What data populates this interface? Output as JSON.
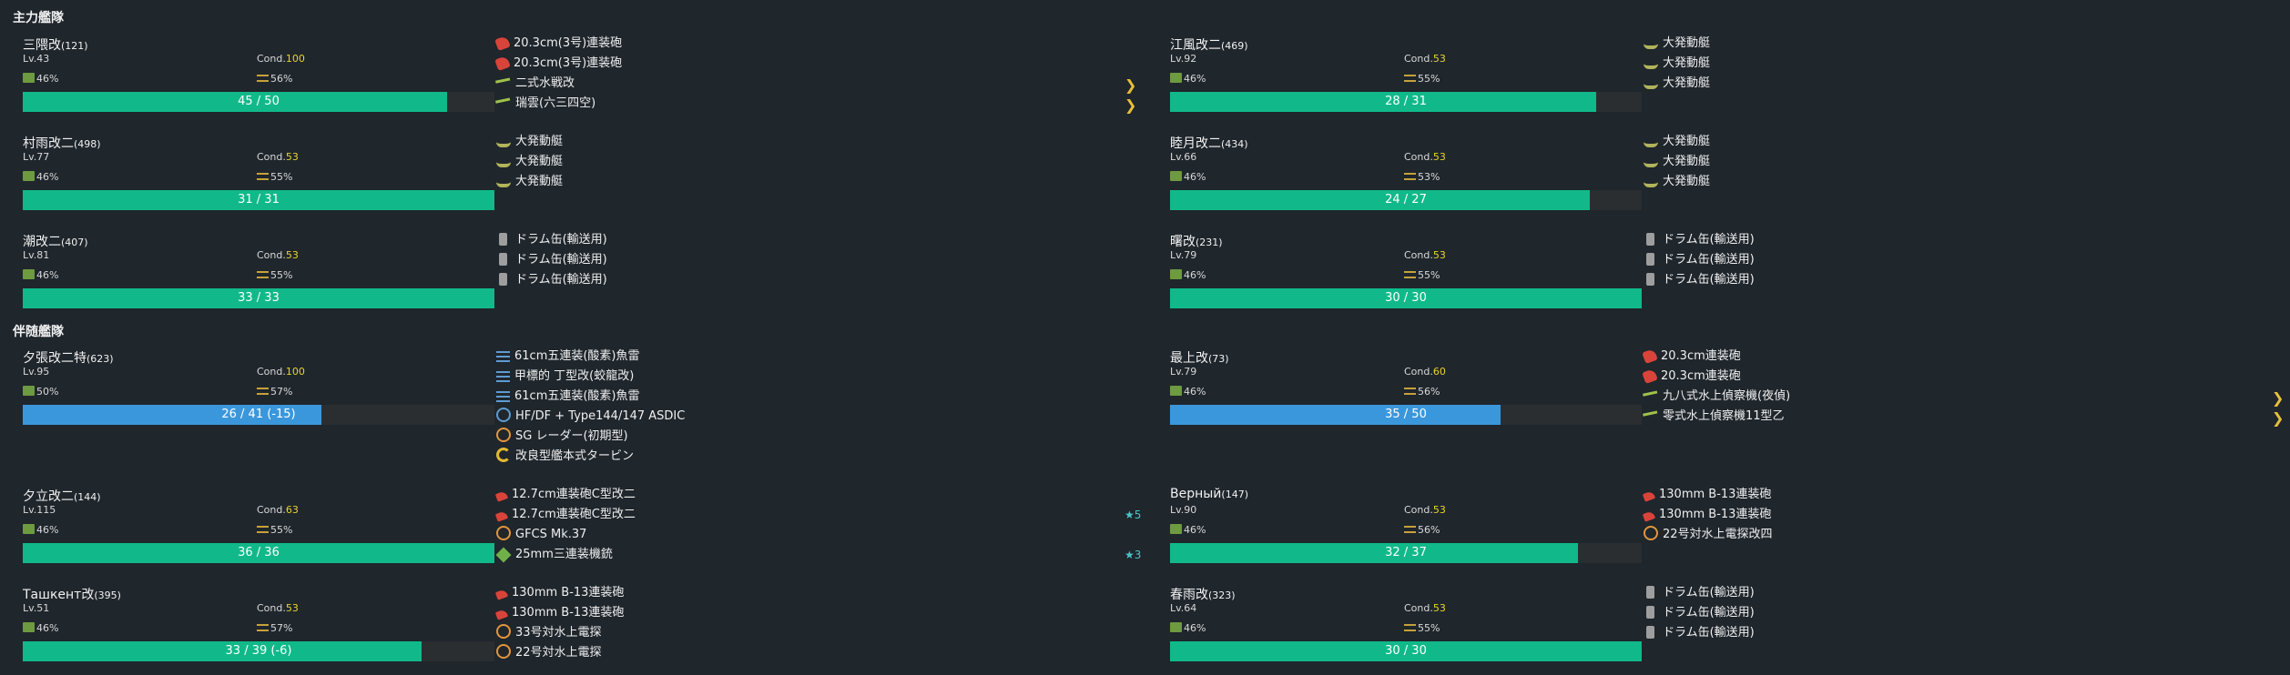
{
  "fleets": {
    "main_title": "主力艦隊",
    "escort_title": "伴随艦隊"
  },
  "labels": {
    "lv_prefix": "Lv.",
    "cond_prefix": "Cond."
  },
  "colors": {
    "hp_green": "#11b98a",
    "hp_blue": "#3b97dc",
    "cond_yellow": "#e8d42d",
    "star_cyan": "#4fc3c7"
  },
  "main_fleet": [
    {
      "name": "三隈改",
      "id": "(121)",
      "lv": "43",
      "cond": "100",
      "fuel": "46%",
      "ammo": "56%",
      "hp": "45 / 50",
      "hp_fraction": 0.9,
      "hp_color": "green",
      "equipment": [
        {
          "icon": "main-gun",
          "name": "20.3cm(3号)連装砲"
        },
        {
          "icon": "main-gun",
          "name": "20.3cm(3号)連装砲"
        },
        {
          "icon": "seaplane",
          "name": "二式水戦改",
          "badge": "chevron"
        },
        {
          "icon": "seaplane",
          "name": "瑞雲(六三四空)",
          "badge": "chevron"
        }
      ]
    },
    {
      "name": "江風改二",
      "id": "(469)",
      "lv": "92",
      "cond": "53",
      "fuel": "46%",
      "ammo": "55%",
      "hp": "28 / 31",
      "hp_fraction": 0.903,
      "hp_color": "green",
      "equipment": [
        {
          "icon": "landing",
          "name": "大発動艇"
        },
        {
          "icon": "landing",
          "name": "大発動艇"
        },
        {
          "icon": "landing",
          "name": "大発動艇"
        }
      ]
    },
    {
      "name": "村雨改二",
      "id": "(498)",
      "lv": "77",
      "cond": "53",
      "fuel": "46%",
      "ammo": "55%",
      "hp": "31 / 31",
      "hp_fraction": 1.0,
      "hp_color": "green",
      "equipment": [
        {
          "icon": "landing",
          "name": "大発動艇"
        },
        {
          "icon": "landing",
          "name": "大発動艇"
        },
        {
          "icon": "landing",
          "name": "大発動艇"
        }
      ]
    },
    {
      "name": "睦月改二",
      "id": "(434)",
      "lv": "66",
      "cond": "53",
      "fuel": "46%",
      "ammo": "53%",
      "hp": "24 / 27",
      "hp_fraction": 0.889,
      "hp_color": "green",
      "equipment": [
        {
          "icon": "landing",
          "name": "大発動艇"
        },
        {
          "icon": "landing",
          "name": "大発動艇"
        },
        {
          "icon": "landing",
          "name": "大発動艇"
        }
      ]
    },
    {
      "name": "潮改二",
      "id": "(407)",
      "lv": "81",
      "cond": "53",
      "fuel": "46%",
      "ammo": "55%",
      "hp": "33 / 33",
      "hp_fraction": 1.0,
      "hp_color": "green",
      "equipment": [
        {
          "icon": "drum",
          "name": "ドラム缶(輸送用)"
        },
        {
          "icon": "drum",
          "name": "ドラム缶(輸送用)"
        },
        {
          "icon": "drum",
          "name": "ドラム缶(輸送用)"
        }
      ]
    },
    {
      "name": "曙改",
      "id": "(231)",
      "lv": "79",
      "cond": "53",
      "fuel": "46%",
      "ammo": "55%",
      "hp": "30 / 30",
      "hp_fraction": 1.0,
      "hp_color": "green",
      "equipment": [
        {
          "icon": "drum",
          "name": "ドラム缶(輸送用)"
        },
        {
          "icon": "drum",
          "name": "ドラム缶(輸送用)"
        },
        {
          "icon": "drum",
          "name": "ドラム缶(輸送用)"
        }
      ]
    }
  ],
  "escort_fleet": [
    {
      "name": "夕張改二特",
      "id": "(623)",
      "lv": "95",
      "cond": "100",
      "fuel": "50%",
      "ammo": "57%",
      "hp": "26 / 41 (-15)",
      "hp_fraction": 0.634,
      "hp_color": "blue",
      "equipment": [
        {
          "icon": "torp",
          "name": "61cm五連装(酸素)魚雷"
        },
        {
          "icon": "torp",
          "name": "甲標的 丁型改(蛟龍改)"
        },
        {
          "icon": "torp",
          "name": "61cm五連装(酸素)魚雷"
        },
        {
          "icon": "sonar",
          "name": "HF/DF + Type144/147 ASDIC"
        },
        {
          "icon": "radar",
          "name": "SG レーダー(初期型)"
        },
        {
          "icon": "turbine",
          "name": "改良型艦本式タービン"
        }
      ]
    },
    {
      "name": "最上改",
      "id": "(73)",
      "lv": "79",
      "cond": "60",
      "fuel": "46%",
      "ammo": "56%",
      "hp": "35 / 50",
      "hp_fraction": 0.7,
      "hp_color": "blue",
      "equipment": [
        {
          "icon": "main-gun",
          "name": "20.3cm連装砲"
        },
        {
          "icon": "main-gun",
          "name": "20.3cm連装砲"
        },
        {
          "icon": "seaplane",
          "name": "九八式水上偵察機(夜偵)",
          "badge": "chevron"
        },
        {
          "icon": "seaplane",
          "name": "零式水上偵察機11型乙",
          "badge": "chevron"
        }
      ]
    },
    {
      "name": "夕立改二",
      "id": "(144)",
      "lv": "115",
      "cond": "63",
      "fuel": "46%",
      "ammo": "55%",
      "hp": "36 / 36",
      "hp_fraction": 1.0,
      "hp_color": "green",
      "equipment": [
        {
          "icon": "small-gun",
          "name": "12.7cm連装砲C型改二"
        },
        {
          "icon": "small-gun",
          "name": "12.7cm連装砲C型改二",
          "badge": "★5"
        },
        {
          "icon": "radar",
          "name": "GFCS Mk.37"
        },
        {
          "icon": "aa",
          "name": "25mm三連装機銃",
          "badge": "★3"
        }
      ]
    },
    {
      "name": "Верный",
      "id": "(147)",
      "lv": "90",
      "cond": "53",
      "fuel": "46%",
      "ammo": "56%",
      "hp": "32 / 37",
      "hp_fraction": 0.865,
      "hp_color": "green",
      "equipment": [
        {
          "icon": "small-gun",
          "name": "130mm B-13連装砲"
        },
        {
          "icon": "small-gun",
          "name": "130mm B-13連装砲"
        },
        {
          "icon": "radar",
          "name": "22号対水上電探改四"
        }
      ]
    },
    {
      "name": "Ташкент改",
      "id": "(395)",
      "lv": "51",
      "cond": "53",
      "fuel": "46%",
      "ammo": "57%",
      "hp": "33 / 39 (-6)",
      "hp_fraction": 0.846,
      "hp_color": "green",
      "equipment": [
        {
          "icon": "small-gun",
          "name": "130mm B-13連装砲"
        },
        {
          "icon": "small-gun",
          "name": "130mm B-13連装砲"
        },
        {
          "icon": "radar",
          "name": "33号対水上電探"
        },
        {
          "icon": "radar",
          "name": "22号対水上電探"
        }
      ]
    },
    {
      "name": "春雨改",
      "id": "(323)",
      "lv": "64",
      "cond": "53",
      "fuel": "46%",
      "ammo": "55%",
      "hp": "30 / 30",
      "hp_fraction": 1.0,
      "hp_color": "green",
      "equipment": [
        {
          "icon": "drum",
          "name": "ドラム缶(輸送用)"
        },
        {
          "icon": "drum",
          "name": "ドラム缶(輸送用)"
        },
        {
          "icon": "drum",
          "name": "ドラム缶(輸送用)"
        }
      ]
    }
  ]
}
